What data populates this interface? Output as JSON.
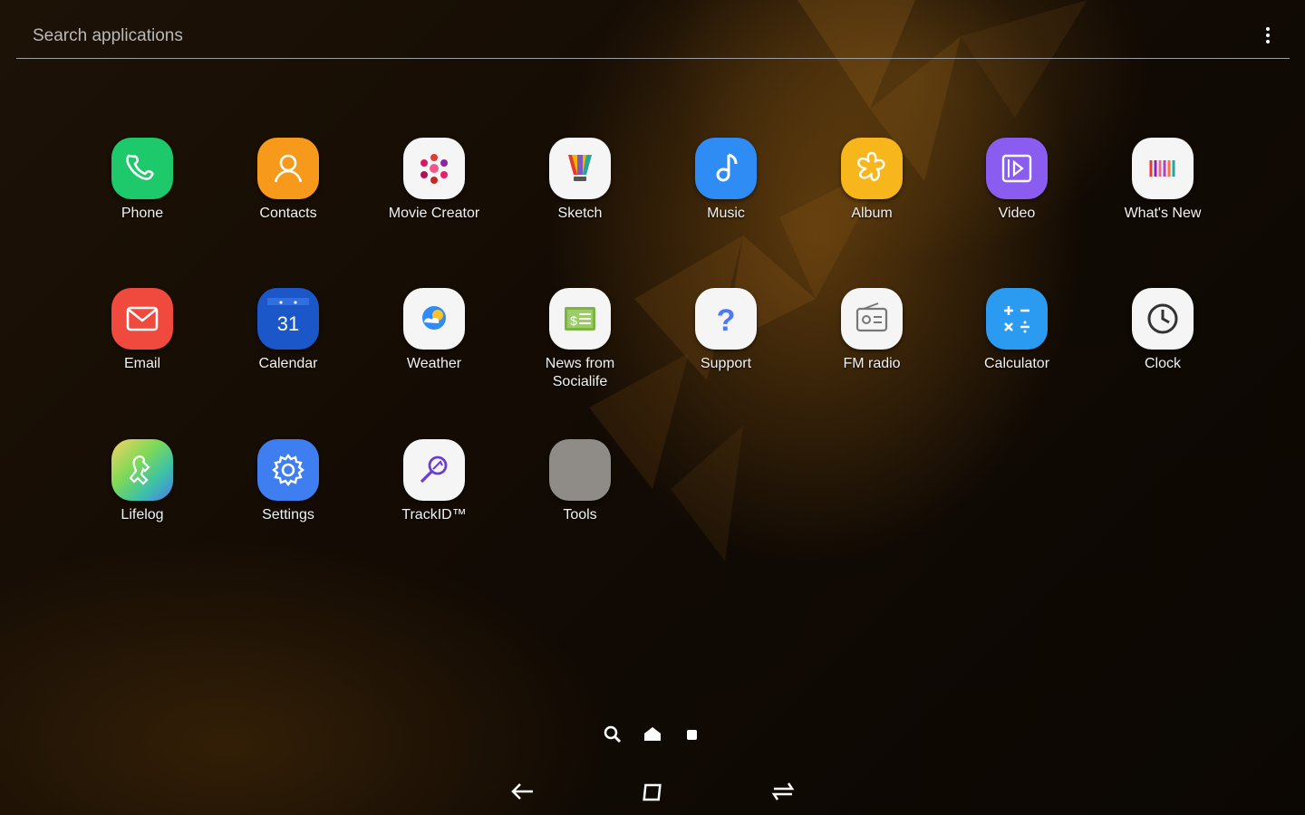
{
  "search": {
    "placeholder": "Search applications"
  },
  "apps": [
    {
      "label": "Phone",
      "icon": "phone-icon",
      "color": "#1ec96b"
    },
    {
      "label": "Contacts",
      "icon": "contacts-icon",
      "color": "#f79a1c"
    },
    {
      "label": "Movie Creator",
      "icon": "movie-creator-icon",
      "color": "#f5f5f5"
    },
    {
      "label": "Sketch",
      "icon": "sketch-icon",
      "color": "#f5f5f5"
    },
    {
      "label": "Music",
      "icon": "music-icon",
      "color": "#2f8cf5"
    },
    {
      "label": "Album",
      "icon": "album-icon",
      "color": "#f7b61b"
    },
    {
      "label": "Video",
      "icon": "video-icon",
      "color": "#8a5cf0"
    },
    {
      "label": "What's New",
      "icon": "whats-new-icon",
      "color": "#f5f5f5"
    },
    {
      "label": "Email",
      "icon": "email-icon",
      "color": "#f04a3e"
    },
    {
      "label": "Calendar",
      "icon": "calendar-icon",
      "color": "#1b57c9",
      "day": "31"
    },
    {
      "label": "Weather",
      "icon": "weather-icon",
      "color": "#f5f5f5"
    },
    {
      "label": "News from Socialife",
      "icon": "news-icon",
      "color": "#f5f5f5"
    },
    {
      "label": "Support",
      "icon": "support-icon",
      "color": "#f5f5f5"
    },
    {
      "label": "FM radio",
      "icon": "fm-radio-icon",
      "color": "#f5f5f5"
    },
    {
      "label": "Calculator",
      "icon": "calculator-icon",
      "color": "#2a9bf0"
    },
    {
      "label": "Clock",
      "icon": "clock-icon",
      "color": "#f5f5f5"
    },
    {
      "label": "Lifelog",
      "icon": "lifelog-icon",
      "color": "#3cc1a8"
    },
    {
      "label": "Settings",
      "icon": "settings-icon",
      "color": "#3f7ef0"
    },
    {
      "label": "TrackID™",
      "icon": "trackid-icon",
      "color": "#f5f5f5"
    },
    {
      "label": "Tools",
      "icon": "tools-folder-icon",
      "color": "#8f8b86"
    }
  ],
  "page_indicator": [
    "search-page",
    "home-page",
    "current-page"
  ],
  "navigation": [
    "back-icon",
    "home-icon",
    "recents-icon"
  ]
}
